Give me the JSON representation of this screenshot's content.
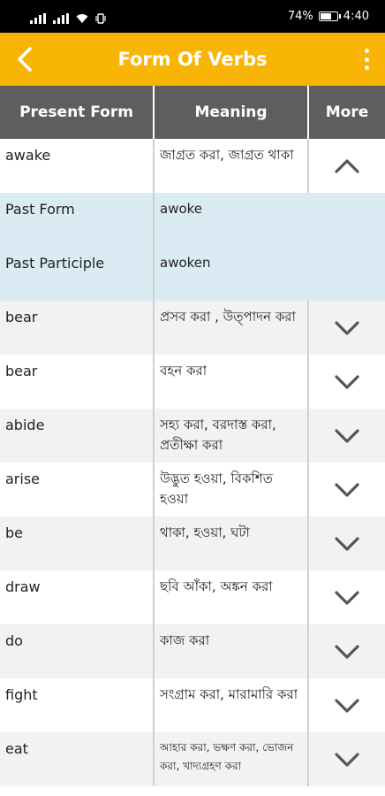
{
  "status": {
    "battery": "74%",
    "time": "4:40",
    "battery_level": 0.74
  },
  "appbar": {
    "title": "Form Of Verbs"
  },
  "header": {
    "col1": "Present Form",
    "col2": "Meaning",
    "col3": "More"
  },
  "rows": [
    {
      "type": "verb",
      "word": "awake",
      "meaning": "জাগ্রত করা, জাগ্রত থাকা",
      "expanded": true
    },
    {
      "type": "detail",
      "label": "Past Form",
      "value": "awoke"
    },
    {
      "type": "detail",
      "label": "Past Participle",
      "value": "awoken"
    },
    {
      "type": "verb",
      "word": "bear",
      "meaning": "প্রসব করা , উত্পাদন করা"
    },
    {
      "type": "verb",
      "word": "bear",
      "meaning": "বহন করা"
    },
    {
      "type": "verb",
      "word": "abide",
      "meaning": "সহ্য করা, বরদাস্ত করা, প্রতীক্ষা করা"
    },
    {
      "type": "verb",
      "word": "arise",
      "meaning": "উদ্ভুত হওয়া, বিকশিত হওয়া"
    },
    {
      "type": "verb",
      "word": "be",
      "meaning": "থাকা, হওয়া, ঘটা"
    },
    {
      "type": "verb",
      "word": "draw",
      "meaning": "ছবি আঁকা, অঙ্কন করা"
    },
    {
      "type": "verb",
      "word": "do",
      "meaning": "কাজ করা"
    },
    {
      "type": "verb",
      "word": "fight",
      "meaning": "সংগ্রাম করা, মারামারি করা"
    },
    {
      "type": "verb",
      "word": "eat",
      "meaning": "আহার করা, ভক্ষণ করা, ভোজন করা, খাদ্যগ্রহণ করা"
    }
  ]
}
